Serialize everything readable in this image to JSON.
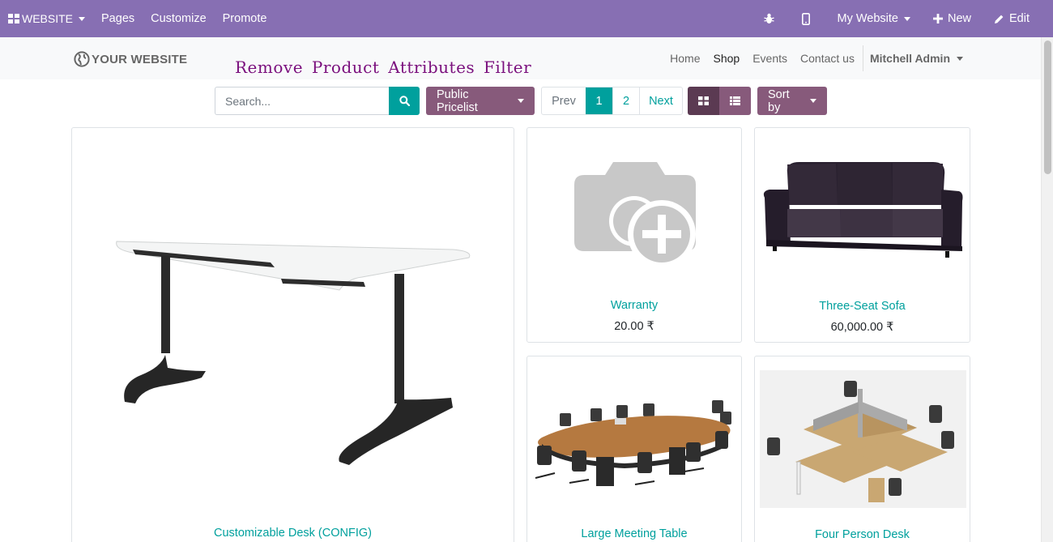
{
  "admin_bar": {
    "brand": "WEBSITE",
    "menu": [
      "Pages",
      "Customize",
      "Promote"
    ],
    "website_switcher": "My Website",
    "new_label": "New",
    "edit_label": "Edit"
  },
  "site": {
    "logo_text": "YOUR WEBSITE",
    "banner_title": "Remove Product Attributes Filter",
    "nav": [
      "Home",
      "Shop",
      "Events",
      "Contact us"
    ],
    "active_nav": "Shop",
    "user": "Mitchell Admin"
  },
  "toolbar": {
    "search_placeholder": "Search...",
    "pricelist": "Public Pricelist",
    "pager": {
      "prev": "Prev",
      "pages": [
        "1",
        "2"
      ],
      "current": "1",
      "next": "Next"
    },
    "sort_label": "Sort by"
  },
  "products": [
    {
      "name": "Customizable Desk (CONFIG)",
      "price": ""
    },
    {
      "name": "Warranty",
      "price": "20.00 ₹"
    },
    {
      "name": "Three-Seat Sofa",
      "price": "60,000.00 ₹"
    },
    {
      "name": "Large Meeting Table",
      "price": ""
    },
    {
      "name": "Four Person Desk",
      "price": ""
    }
  ],
  "colors": {
    "admin_bar": "#876fb3",
    "primary_teal": "#00a09d",
    "button_purple": "#875a7b",
    "banner_title": "#7a0f7d"
  }
}
